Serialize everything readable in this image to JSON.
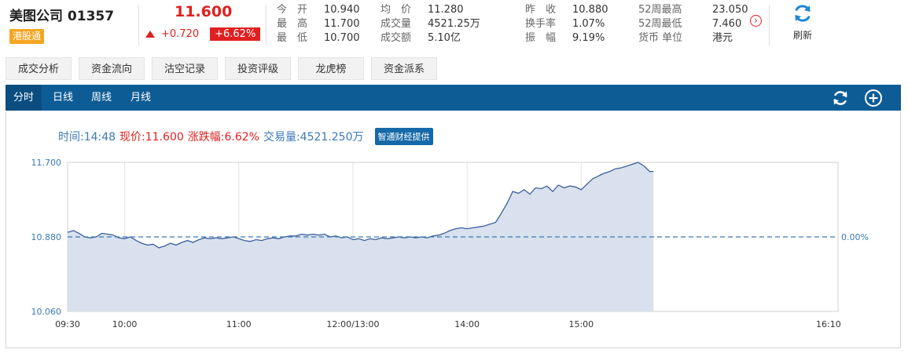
{
  "header": {
    "stock_name": "美图公司 01357",
    "badge": "港股通",
    "price": "11.600",
    "change": "+0.720",
    "change_pct": "+6.62%",
    "refresh_label": "刷新"
  },
  "quote": {
    "col1": [
      {
        "label": "今　开",
        "value": "10.940"
      },
      {
        "label": "最　高",
        "value": "11.700"
      },
      {
        "label": "最　低",
        "value": "10.700"
      }
    ],
    "col2": [
      {
        "label": "均　价",
        "value": "11.280"
      },
      {
        "label": "成交量",
        "value": "4521.25万"
      },
      {
        "label": "成交额",
        "value": "5.10亿"
      }
    ],
    "col3": [
      {
        "label": "昨　收",
        "value": "10.880"
      },
      {
        "label": "换手率",
        "value": "1.07%"
      },
      {
        "label": "振　幅",
        "value": "9.19%"
      }
    ],
    "col4": [
      {
        "label": "52周最高",
        "value": "23.050"
      },
      {
        "label": "52周最低",
        "value": "7.460"
      },
      {
        "label": "货币 单位",
        "value": "港元"
      }
    ]
  },
  "tabs": [
    "成交分析",
    "资金流向",
    "沽空记录",
    "投资评级",
    "龙虎榜",
    "资金派系"
  ],
  "nav": [
    "分时",
    "日线",
    "周线",
    "月线"
  ],
  "info": {
    "time_label": "时间:14:48",
    "price_label": "现价:11.600",
    "pct_label": "涨跌幅:6.62%",
    "volume_label": "交易量:4521.250万",
    "provider": "智通财经提供"
  },
  "colors": {
    "up": "#e02020",
    "nav_bg": "#0e5c96",
    "line": "#3d5f9e",
    "fill": "#d8e1ed",
    "ref_line": "#3a7ab8"
  },
  "icons": {
    "refresh": "refresh-icon",
    "more": "chevron-right-circle-icon",
    "reload": "reload-icon",
    "add": "add-circle-icon",
    "up": "triangle-up-icon"
  },
  "chart_data": {
    "type": "area",
    "title": "",
    "xlabel": "",
    "ylabel": "",
    "ylim": [
      10.06,
      11.7
    ],
    "y_ticks": [
      "11.700",
      "10.880",
      "10.060"
    ],
    "x_ticks": [
      "09:30",
      "10:00",
      "11:00",
      "12:00/13:00",
      "14:00",
      "15:00",
      "16:10"
    ],
    "reference": {
      "value": 10.88,
      "label": "0.00%"
    },
    "grid": true,
    "series": [
      {
        "values": [
          [
            0,
            10.93
          ],
          [
            3,
            10.95
          ],
          [
            6,
            10.92
          ],
          [
            9,
            10.88
          ],
          [
            12,
            10.87
          ],
          [
            15,
            10.88
          ],
          [
            18,
            10.92
          ],
          [
            21,
            10.91
          ],
          [
            24,
            10.9
          ],
          [
            27,
            10.87
          ],
          [
            30,
            10.86
          ],
          [
            33,
            10.88
          ],
          [
            36,
            10.84
          ],
          [
            39,
            10.81
          ],
          [
            42,
            10.79
          ],
          [
            45,
            10.8
          ],
          [
            48,
            10.76
          ],
          [
            51,
            10.78
          ],
          [
            54,
            10.81
          ],
          [
            57,
            10.79
          ],
          [
            60,
            10.82
          ],
          [
            63,
            10.84
          ],
          [
            66,
            10.82
          ],
          [
            69,
            10.85
          ],
          [
            72,
            10.87
          ],
          [
            75,
            10.86
          ],
          [
            78,
            10.87
          ],
          [
            81,
            10.86
          ],
          [
            84,
            10.87
          ],
          [
            87,
            10.88
          ],
          [
            90,
            10.86
          ],
          [
            93,
            10.84
          ],
          [
            96,
            10.83
          ],
          [
            99,
            10.85
          ],
          [
            102,
            10.84
          ],
          [
            105,
            10.86
          ],
          [
            108,
            10.87
          ],
          [
            111,
            10.86
          ],
          [
            114,
            10.88
          ],
          [
            117,
            10.89
          ],
          [
            120,
            10.89
          ],
          [
            123,
            10.91
          ],
          [
            126,
            10.9
          ],
          [
            129,
            10.91
          ],
          [
            132,
            10.9
          ],
          [
            135,
            10.91
          ],
          [
            138,
            10.88
          ],
          [
            141,
            10.89
          ],
          [
            144,
            10.87
          ],
          [
            147,
            10.88
          ],
          [
            150,
            10.85
          ],
          [
            153,
            10.86
          ],
          [
            156,
            10.84
          ],
          [
            159,
            10.86
          ],
          [
            162,
            10.85
          ],
          [
            165,
            10.87
          ],
          [
            168,
            10.86
          ],
          [
            171,
            10.87
          ],
          [
            174,
            10.88
          ],
          [
            177,
            10.87
          ],
          [
            180,
            10.88
          ],
          [
            183,
            10.87
          ],
          [
            186,
            10.88
          ],
          [
            189,
            10.87
          ],
          [
            192,
            10.89
          ],
          [
            195,
            10.9
          ],
          [
            198,
            10.92
          ],
          [
            201,
            10.95
          ],
          [
            204,
            10.97
          ],
          [
            207,
            10.98
          ],
          [
            210,
            10.97
          ],
          [
            213,
            10.98
          ],
          [
            216,
            10.99
          ],
          [
            219,
            11.0
          ],
          [
            222,
            11.02
          ],
          [
            225,
            11.04
          ],
          [
            228,
            11.14
          ],
          [
            231,
            11.25
          ],
          [
            234,
            11.38
          ],
          [
            237,
            11.36
          ],
          [
            240,
            11.4
          ],
          [
            243,
            11.35
          ],
          [
            246,
            11.42
          ],
          [
            249,
            11.41
          ],
          [
            252,
            11.44
          ],
          [
            255,
            11.38
          ],
          [
            258,
            11.45
          ],
          [
            261,
            11.42
          ],
          [
            264,
            11.44
          ],
          [
            267,
            11.43
          ],
          [
            270,
            11.4
          ],
          [
            273,
            11.46
          ],
          [
            276,
            11.52
          ],
          [
            279,
            11.55
          ],
          [
            282,
            11.58
          ],
          [
            285,
            11.6
          ],
          [
            288,
            11.63
          ],
          [
            291,
            11.64
          ],
          [
            294,
            11.66
          ],
          [
            297,
            11.68
          ],
          [
            300,
            11.7
          ],
          [
            303,
            11.66
          ],
          [
            306,
            11.6
          ],
          [
            308,
            11.6
          ]
        ]
      }
    ]
  }
}
